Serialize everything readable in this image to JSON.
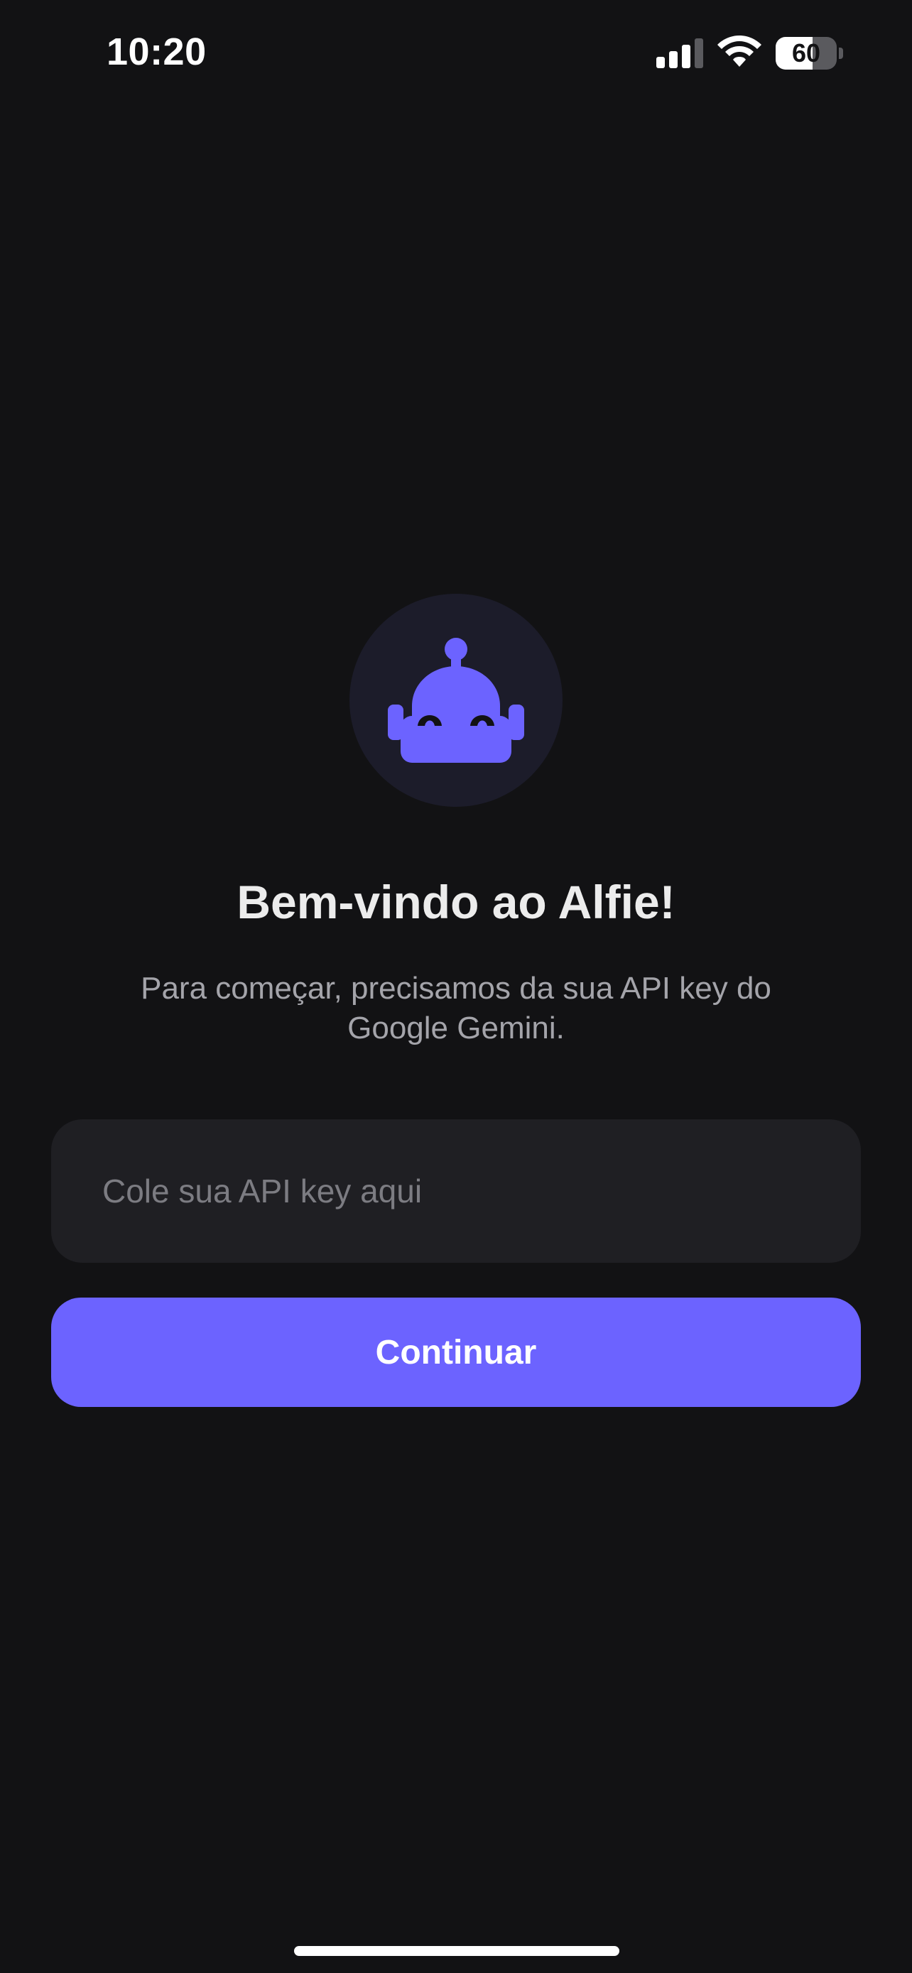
{
  "status_bar": {
    "time": "10:20",
    "battery_level": "60",
    "battery_fraction": 0.6,
    "icons": [
      "signal-icon",
      "wifi-icon",
      "battery-icon"
    ]
  },
  "onboarding": {
    "avatar_icon": "robot-icon",
    "title": "Bem-vindo ao Alfie!",
    "subtitle": "Para começar, precisamos da sua API key do Google Gemini.",
    "api_key_input": {
      "value": "",
      "placeholder": "Cole sua API key aqui"
    },
    "continue_label": "Continuar"
  },
  "colors": {
    "background": "#121214",
    "accent": "#6c63ff",
    "avatar_background": "#1c1c2a",
    "input_background": "#1f1f23",
    "title_text": "#ececec",
    "subtitle_text": "#a4a4aa",
    "placeholder_text": "#7c7c82"
  }
}
